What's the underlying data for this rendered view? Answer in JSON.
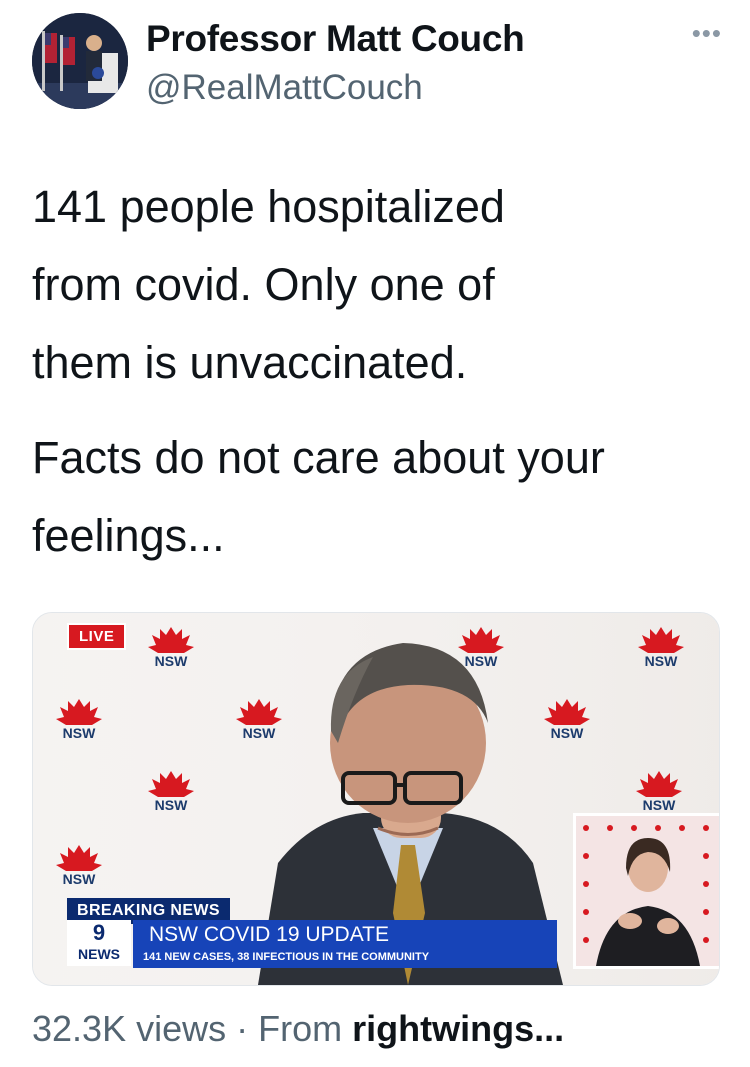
{
  "tweet": {
    "author_name": "Professor Matt Couch",
    "handle": "@RealMattCouch",
    "more_icon": "more-dots-icon",
    "text_paragraphs": [
      "141 people hospitalized\nfrom covid. Only one of\nthem is unvaccinated.",
      "Facts do not care about your\nfeelings..."
    ]
  },
  "media": {
    "live_badge": "LIVE",
    "logo_text": "NSW",
    "breaking_label": "BREAKING NEWS",
    "channel_number": "9",
    "channel_label": "NEWS",
    "headline": "NSW COVID 19 UPDATE",
    "subline": "141 NEW CASES, 38 INFECTIOUS IN THE COMMUNITY"
  },
  "footer": {
    "views": "32.3K views",
    "separator": "·",
    "from_label": "From",
    "source": "rightwings..."
  },
  "colors": {
    "text": "#0f1419",
    "secondary": "#536471",
    "live_red": "#d71920",
    "bar_blue": "#1744b8",
    "navy": "#0b2a6f"
  }
}
